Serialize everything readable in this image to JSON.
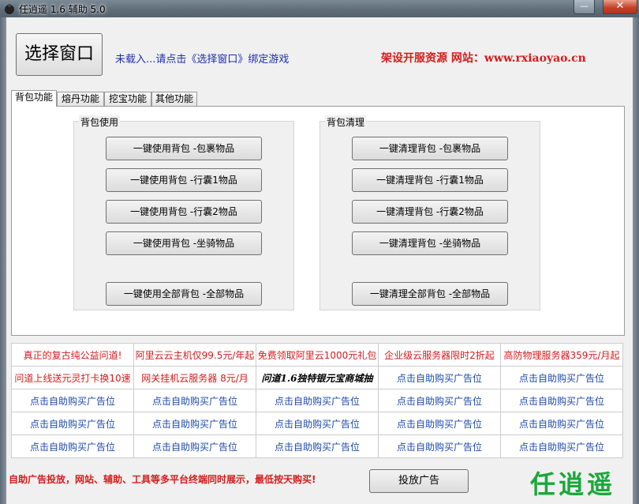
{
  "window": {
    "title": "任逍遥 1.6 辅助 5.0",
    "controls": {
      "minimize": "—",
      "maximize": "□",
      "close": "✕"
    }
  },
  "header": {
    "select_window_label": "选择窗口",
    "status": "未载入...请点击《选择窗口》绑定游戏",
    "site": "架设开服资源 网站：www.rxiaoyao.cn"
  },
  "tabs": [
    "背包功能",
    "熔丹功能",
    "挖宝功能",
    "其他功能"
  ],
  "backpack_use": {
    "title": "背包使用",
    "buttons": [
      "一键使用背包 -包裹物品",
      "一键使用背包 -行囊1物品",
      "一键使用背包 -行囊2物品",
      "一键使用背包 -坐骑物品",
      "一键使用全部背包 -全部物品"
    ]
  },
  "backpack_clean": {
    "title": "背包清理",
    "buttons": [
      "一键清理背包 -包裹物品",
      "一键清理背包 -行囊1物品",
      "一键清理背包 -行囊2物品",
      "一键清理背包 -坐骑物品",
      "一键清理全部背包 -全部物品"
    ]
  },
  "ads": {
    "rows": [
      [
        "真正的复古纯公益问道!",
        "阿里云云主机仅99.5元/年起",
        "免费领取阿里云1000元礼包",
        "企业级云服务器限时2折起",
        "高防物理服务器359元/月起"
      ],
      [
        "问道上线送元灵打卡换10速",
        "网关挂机云服务器 8元/月",
        "问道1.6独特银元宝商城抽",
        "点击自助购买广告位",
        "点击自助购买广告位"
      ],
      [
        "点击自助购买广告位",
        "点击自助购买广告位",
        "点击自助购买广告位",
        "点击自助购买广告位",
        "点击自助购买广告位"
      ],
      [
        "点击自助购买广告位",
        "点击自助购买广告位",
        "点击自助购买广告位",
        "点击自助购买广告位",
        "点击自助购买广告位"
      ],
      [
        "点击自助购买广告位",
        "点击自助购买广告位",
        "点击自助购买广告位",
        "点击自助购买广告位",
        "点击自助购买广告位"
      ]
    ]
  },
  "footer": {
    "promo": "自助广告投放，网站、辅助、工具等多平台终端同时展示，最低按天购买!",
    "place_ad_label": "投放广告",
    "logo_text": "任逍遥"
  },
  "colors": {
    "red": "#d31c1c",
    "blue": "#1f4aa8",
    "logo_green": "#1aa83a"
  }
}
